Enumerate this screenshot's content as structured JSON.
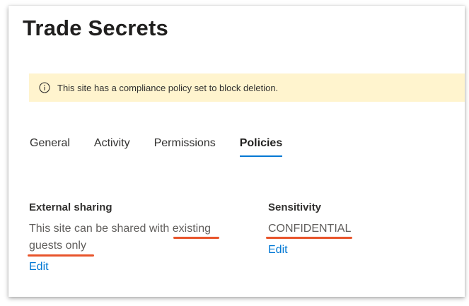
{
  "page": {
    "title": "Trade Secrets"
  },
  "banner": {
    "icon": "info-icon",
    "message": "This site has a compliance policy set to block deletion."
  },
  "tabs": [
    {
      "label": "General",
      "active": false
    },
    {
      "label": "Activity",
      "active": false
    },
    {
      "label": "Permissions",
      "active": false
    },
    {
      "label": "Policies",
      "active": true
    }
  ],
  "external_sharing": {
    "label": "External sharing",
    "text_line1": "This site can be shared with existing",
    "text_line2": "guests only",
    "edit_label": "Edit"
  },
  "sensitivity": {
    "label": "Sensitivity",
    "value": "CONFIDENTIAL",
    "edit_label": "Edit"
  },
  "colors": {
    "accent": "#0078d4",
    "banner_bg": "#fff4ce",
    "annotation": "#e8542b"
  }
}
